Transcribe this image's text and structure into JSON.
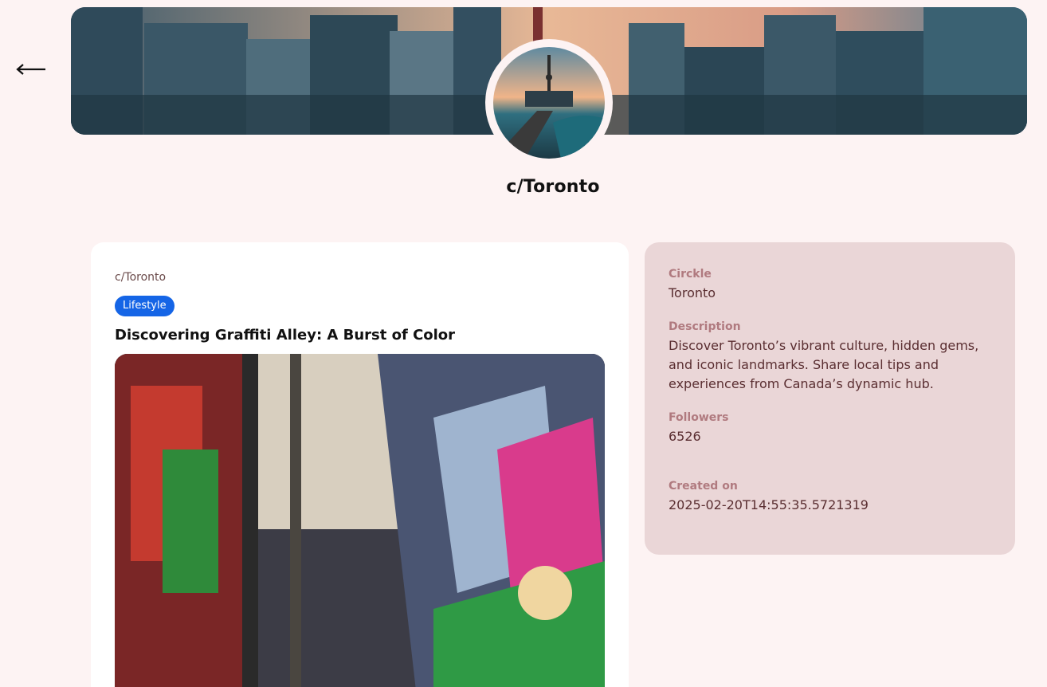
{
  "nav": {
    "back_icon": "arrow-left-icon"
  },
  "header": {
    "community_name": "c/Toronto"
  },
  "post": {
    "community": "c/Toronto",
    "tag": "Lifestyle",
    "title": "Discovering Graffiti Alley: A Burst of Color"
  },
  "info": {
    "circle_label": "Circkle",
    "circle_value": "Toronto",
    "description_label": "Description",
    "description_value": "Discover Toronto’s vibrant culture, hidden gems, and iconic landmarks. Share local tips and experiences from Canada’s dynamic hub.",
    "followers_label": "Followers",
    "followers_value": "6526",
    "created_label": "Created on",
    "created_value": "2025-02-20T14:55:35.5721319"
  },
  "colors": {
    "page_bg": "#fdf3f3",
    "tag_bg": "#1565e6",
    "panel_bg": "#ead6d7",
    "label_color": "#b07a7f",
    "value_color": "#5a2e31"
  }
}
